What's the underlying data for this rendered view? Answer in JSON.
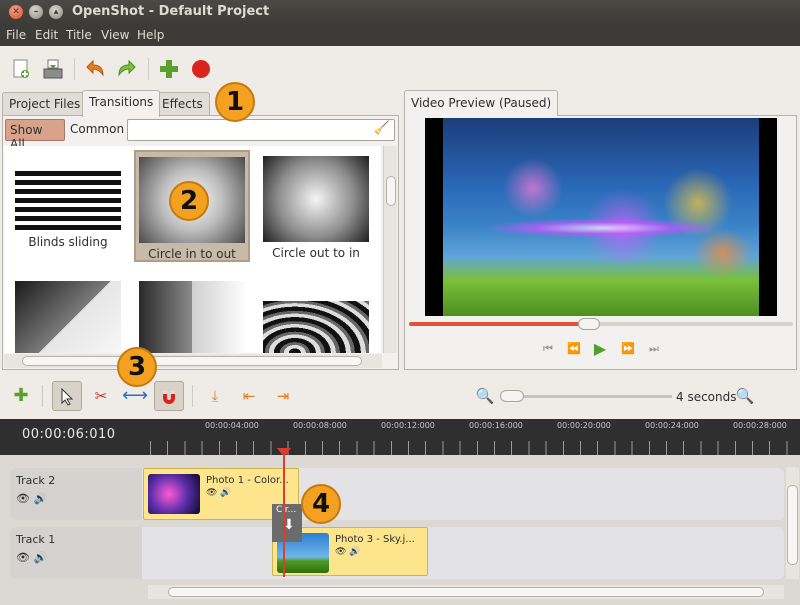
{
  "window": {
    "title": "OpenShot - Default Project"
  },
  "menu": [
    "File",
    "Edit",
    "Title",
    "View",
    "Help"
  ],
  "toolbar": {
    "icons": [
      "new-project-icon",
      "save-project-icon",
      "undo-icon",
      "redo-icon",
      "import-files-icon",
      "record-icon"
    ]
  },
  "left_tabs": [
    "Project Files",
    "Transitions",
    "Effects"
  ],
  "active_left_tab": "Transitions",
  "filter": {
    "show_all": "Show All",
    "common": "Common",
    "search_value": ""
  },
  "transitions": [
    {
      "label": "Blinds sliding"
    },
    {
      "label": "Circle in to out",
      "selected": true
    },
    {
      "label": "Circle out to in"
    },
    {
      "label": ""
    },
    {
      "label": ""
    },
    {
      "label": ""
    }
  ],
  "preview": {
    "tab": "Video Preview (Paused)",
    "progress": 0.47
  },
  "timeline": {
    "zoom_label": "4 seconds",
    "timecode": "00:00:06:010",
    "ruler_labels": [
      "00:00:04:000",
      "00:00:08:000",
      "00:00:12:000",
      "00:00:16:000",
      "00:00:20:000",
      "00:00:24:000",
      "00:00:28:000"
    ],
    "tracks": [
      {
        "name": "Track 2",
        "clip_title": "Photo 1 - Color..."
      },
      {
        "name": "Track 1",
        "clip_title": "Photo 3 - Sky.j..."
      }
    ],
    "transition_label": "Cir..."
  },
  "callouts": [
    "1",
    "2",
    "3",
    "4"
  ],
  "colors": {
    "accent": "#f4a020",
    "playhead": "#e03c2e",
    "clip": "#fce58c"
  }
}
